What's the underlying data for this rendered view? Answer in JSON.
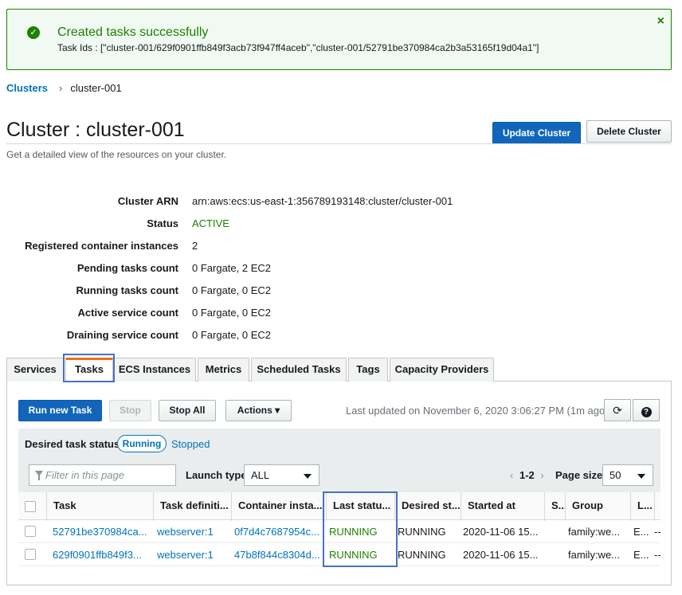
{
  "flash": {
    "title": "Created tasks successfully",
    "task_ids": "Task Ids : [\"cluster-001/629f0901ffb849f3acb73f947ff4aceb\",\"cluster-001/52791be370984ca2b3a53165f19d04a1\"]",
    "close": "×",
    "ok": "✓"
  },
  "breadcrumb": {
    "root": "Clusters",
    "sep": "›",
    "current": "cluster-001"
  },
  "header": {
    "title": "Cluster : cluster-001",
    "subtitle": "Get a detailed view of the resources on your cluster.",
    "update_button": "Update Cluster",
    "delete_button": "Delete Cluster"
  },
  "details": [
    {
      "label": "Cluster ARN",
      "value": "arn:aws:ecs:us-east-1:356789193148:cluster/cluster-001"
    },
    {
      "label": "Status",
      "value": "ACTIVE"
    },
    {
      "label": "Registered container instances",
      "value": "2"
    },
    {
      "label": "Pending tasks count",
      "value": "0 Fargate, 2 EC2"
    },
    {
      "label": "Running tasks count",
      "value": "0 Fargate, 0 EC2"
    },
    {
      "label": "Active service count",
      "value": "0 Fargate, 0 EC2"
    },
    {
      "label": "Draining service count",
      "value": "0 Fargate, 0 EC2"
    }
  ],
  "tabs": [
    "Services",
    "Tasks",
    "ECS Instances",
    "Metrics",
    "Scheduled Tasks",
    "Tags",
    "Capacity Providers"
  ],
  "toolbar": {
    "run_new_task": "Run new Task",
    "stop": "Stop",
    "stop_all": "Stop All",
    "actions": "Actions",
    "actions_caret": "▾",
    "last_updated": "Last updated on November 6, 2020 3:06:27 PM (1m ago)",
    "refresh": "⟳",
    "help": "?"
  },
  "filters": {
    "desired_label": "Desired task status:",
    "running": "Running",
    "stopped": "Stopped",
    "filter_placeholder": "Filter in this page",
    "launch_type_label": "Launch type",
    "launch_type_value": "ALL",
    "pager_prev": "‹",
    "pager_range": "1-2",
    "pager_next": "›",
    "page_size_label": "Page size",
    "page_size_value": "50"
  },
  "table": {
    "columns": [
      "Task",
      "Task definiti...",
      "Container insta...",
      "Last statu...",
      "Desired st...",
      "Started at",
      "S...",
      "Group",
      "L..."
    ],
    "rows": [
      [
        "52791be370984ca...",
        "webserver:1",
        "0f7d4c7687954c...",
        "RUNNING",
        "RUNNING",
        "2020-11-06 15...",
        "",
        "family:we...",
        "E...",
        "--"
      ],
      [
        "629f0901ffb849f3...",
        "webserver:1",
        "47b8f844c8304d...",
        "RUNNING",
        "RUNNING",
        "2020-11-06 15...",
        "",
        "family:we...",
        "E...",
        "--"
      ]
    ]
  },
  "colors": {
    "success": "#1d8102",
    "link": "#0073bb",
    "primary": "#1166bb",
    "accent_tab": "#ec7211",
    "highlight": "#4472c4"
  }
}
